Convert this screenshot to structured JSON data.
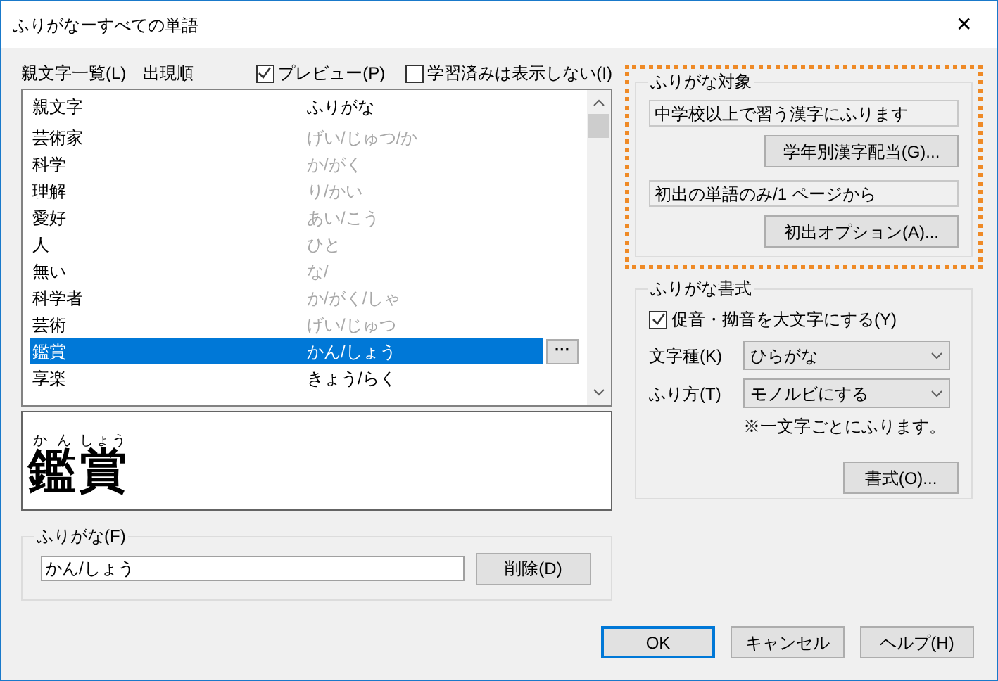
{
  "window": {
    "title": "ふりがなーすべての単語",
    "close": "✕"
  },
  "list_header": {
    "label": "親文字一覧(L)",
    "order": "出現順"
  },
  "options": [
    {
      "label": "プレビュー(P)",
      "checked": true
    },
    {
      "label": "学習済みは表示しない(I)",
      "checked": false
    }
  ],
  "table": {
    "columns": [
      "親文字",
      "ふりがな"
    ],
    "rows": [
      {
        "base": "芸術家",
        "reading": "げい/じゅつ/か",
        "dimmed": true,
        "selected": false
      },
      {
        "base": "科学",
        "reading": "か/がく",
        "dimmed": true,
        "selected": false
      },
      {
        "base": "理解",
        "reading": "り/かい",
        "dimmed": true,
        "selected": false
      },
      {
        "base": "愛好",
        "reading": "あい/こう",
        "dimmed": true,
        "selected": false
      },
      {
        "base": "人",
        "reading": "ひと",
        "dimmed": true,
        "selected": false
      },
      {
        "base": "無い",
        "reading": "な/",
        "dimmed": true,
        "selected": false
      },
      {
        "base": "科学者",
        "reading": "か/がく/しゃ",
        "dimmed": true,
        "selected": false
      },
      {
        "base": "芸術",
        "reading": "げい/じゅつ",
        "dimmed": true,
        "selected": false
      },
      {
        "base": "鑑賞",
        "reading": "かん/しょう",
        "dimmed": false,
        "selected": true
      },
      {
        "base": "享楽",
        "reading": "きょう/らく",
        "dimmed": false,
        "selected": false
      }
    ],
    "row_button": "···"
  },
  "preview": {
    "segments": [
      {
        "base": "鑑",
        "ruby": "かん"
      },
      {
        "base": "賞",
        "ruby": "しょう"
      }
    ]
  },
  "furigana_group": {
    "title": "ふりがな(F)",
    "value": "かん/しょう",
    "delete_button": "削除(D)"
  },
  "target_group": {
    "title": "ふりがな対象",
    "fields": [
      {
        "value": "中学校以上で習う漢字にふります",
        "button": "学年別漢字配当(G)..."
      },
      {
        "value": "初出の単語のみ/1 ページから",
        "button": "初出オプション(A)..."
      }
    ]
  },
  "format_group": {
    "title": "ふりがな書式",
    "checkbox": {
      "label": "促音・拗音を大文字にする(Y)",
      "checked": true
    },
    "selects": [
      {
        "label": "文字種(K)",
        "value": "ひらがな"
      },
      {
        "label": "ふり方(T)",
        "value": "モノルビにする"
      }
    ],
    "note": "※一文字ごとにふります。",
    "button": "書式(O)..."
  },
  "buttons": [
    {
      "label": "OK",
      "default": true
    },
    {
      "label": "キャンセル",
      "default": false
    },
    {
      "label": "ヘルプ(H)",
      "default": false
    }
  ]
}
